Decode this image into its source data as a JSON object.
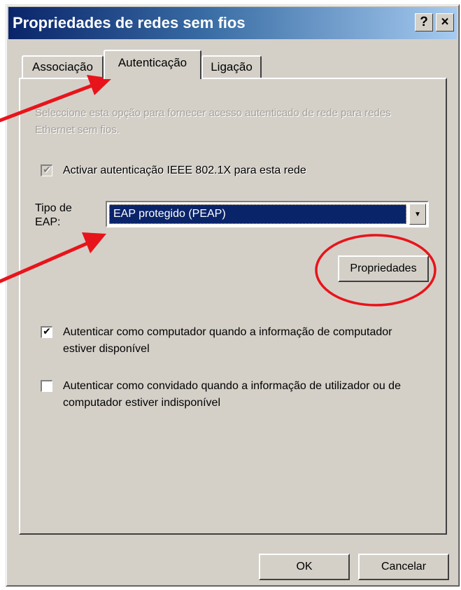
{
  "window": {
    "title": "Propriedades de redes sem fios",
    "help_label": "?",
    "close_label": "×"
  },
  "tabs": [
    {
      "label": "Associação",
      "active": false
    },
    {
      "label": "Autenticação",
      "active": true
    },
    {
      "label": "Ligação",
      "active": false
    }
  ],
  "panel": {
    "description": "Seleccione esta opção para fornecer acesso autenticado de rede para redes Ethernet sem fios.",
    "enable_8021x": {
      "label": "Activar autenticação IEEE 802.1X para esta rede",
      "checked": true,
      "disabled": true
    },
    "eap_type": {
      "label": "Tipo de EAP:",
      "value": "EAP protegido (PEAP)"
    },
    "properties_button": "Propriedades",
    "auth_as_computer": {
      "label": "Autenticar como computador quando a informação de computador estiver disponível",
      "checked": true
    },
    "auth_as_guest": {
      "label": "Autenticar como convidado quando a informação de utilizador ou de computador estiver indisponível",
      "checked": false
    }
  },
  "footer": {
    "ok_label": "OK",
    "cancel_label": "Cancelar"
  },
  "icons": {
    "checkmark": "✔",
    "dropdown": "▼"
  },
  "colors": {
    "title_start": "#0a246a",
    "title_end": "#a6caf0",
    "face": "#d4d0c8",
    "selection": "#0a246a",
    "annotation_red": "#e8141b"
  }
}
